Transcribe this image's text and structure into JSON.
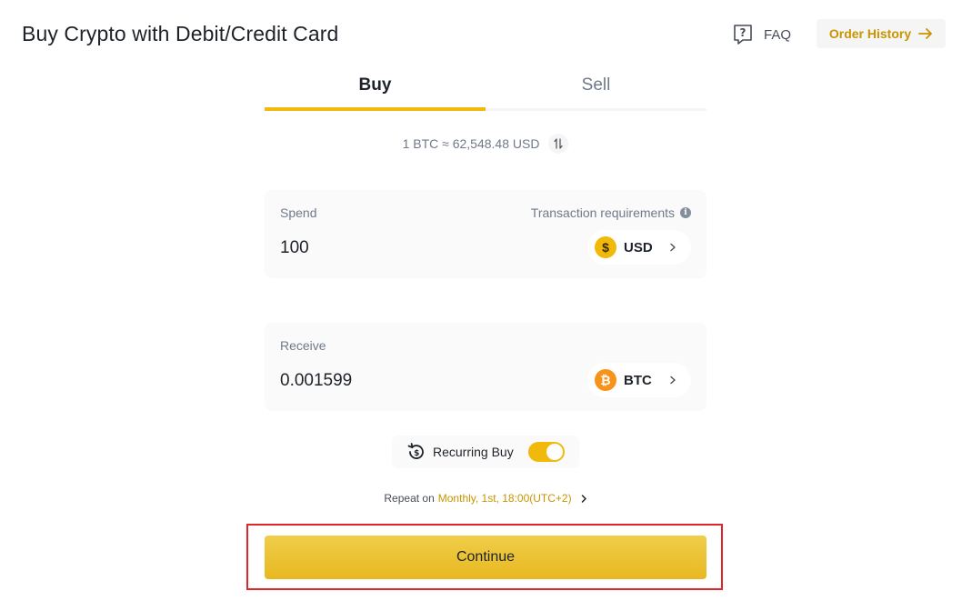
{
  "header": {
    "title": "Buy Crypto with Debit/Credit Card",
    "faq_label": "FAQ",
    "order_history_label": "Order History"
  },
  "tabs": [
    {
      "label": "Buy",
      "active": true
    },
    {
      "label": "Sell",
      "active": false
    }
  ],
  "rate": {
    "text": "1 BTC ≈ 62,548.48 USD"
  },
  "spend": {
    "label": "Spend",
    "requirements_label": "Transaction requirements",
    "value": "100",
    "currency": "USD",
    "currency_symbol": "$"
  },
  "receive": {
    "label": "Receive",
    "value": "0.001599",
    "currency": "BTC",
    "currency_symbol": "₿"
  },
  "recurring": {
    "label": "Recurring Buy",
    "enabled": true
  },
  "repeat": {
    "label": "Repeat on",
    "value": "Monthly, 1st, 18:00(UTC+2)"
  },
  "continue_label": "Continue",
  "colors": {
    "accent": "#f0b90b",
    "accent_text": "#c99400",
    "highlight": "#e0262b"
  }
}
